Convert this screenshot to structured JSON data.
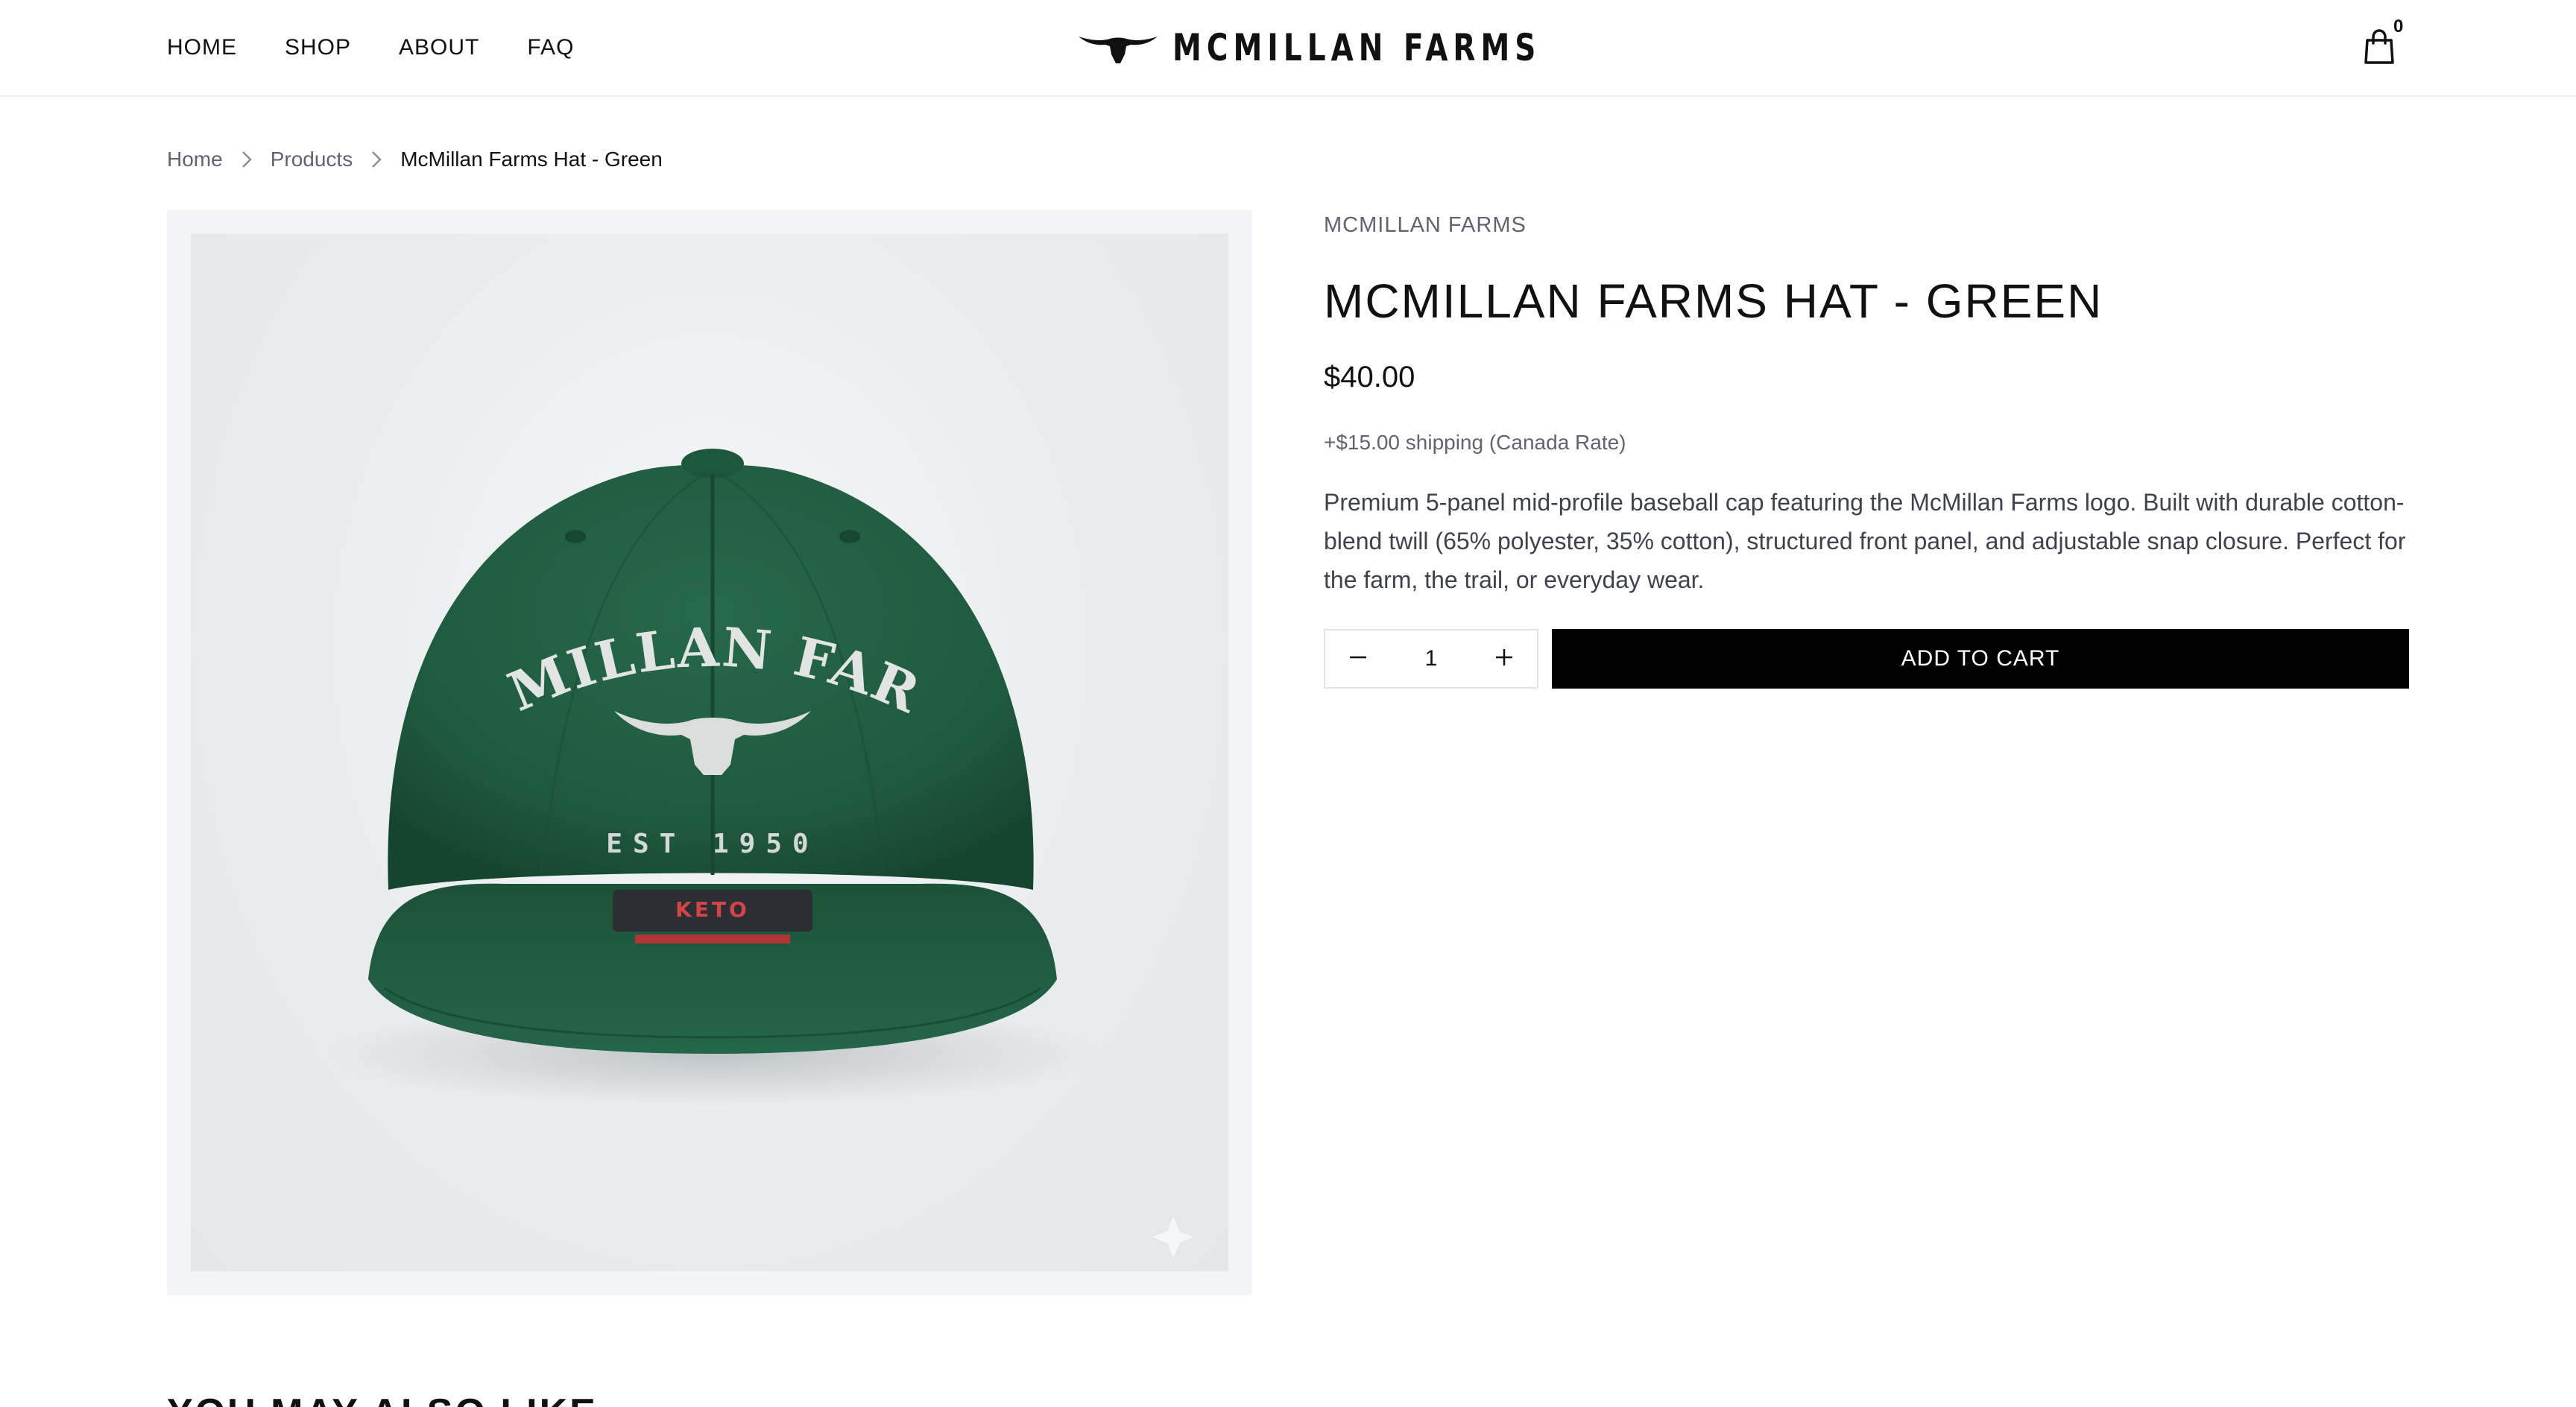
{
  "header": {
    "nav": [
      "HOME",
      "SHOP",
      "ABOUT",
      "FAQ"
    ],
    "logo_text": "MCMILLAN FARMS",
    "cart_count": "0"
  },
  "breadcrumb": {
    "home": "Home",
    "products": "Products",
    "current": "McMillan Farms Hat - Green"
  },
  "product": {
    "image_alt": "McMillan Farms Hat - Green",
    "hat_print": {
      "brand": "MCMILLAN FARMS",
      "established": "EST 1950",
      "tag": "KETO"
    },
    "vendor": "MCMILLAN FARMS",
    "title": "MCMILLAN FARMS HAT - GREEN",
    "price": "$40.00",
    "shipping": "+$15.00 shipping (Canada Rate)",
    "description": "Premium 5-panel mid-profile baseball cap featuring the McMillan Farms logo. Built with durable cotton-blend twill (65% polyester, 35% cotton), structured front panel, and adjustable snap closure. Perfect for the farm, the trail, or everyday wear.",
    "quantity": "1",
    "add_to_cart_label": "ADD TO CART",
    "hat_color": "#1f5a3e"
  },
  "related": {
    "title": "YOU MAY ALSO LIKE"
  },
  "icons": {
    "cart": "shopping-bag-icon",
    "breadcrumb_sep": "chevron-right-icon",
    "minus": "minus-icon",
    "plus": "plus-icon",
    "logo": "longhorn-icon"
  }
}
